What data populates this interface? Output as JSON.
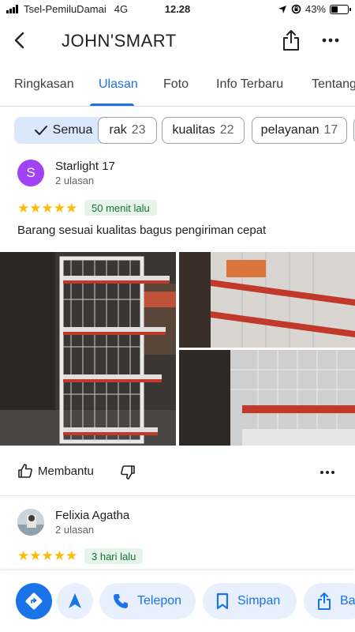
{
  "status_bar": {
    "carrier": "Tsel-PemiluDamai",
    "network": "4G",
    "time": "12.28",
    "battery_percent": "43%",
    "battery_level": 0.43
  },
  "header": {
    "title": "JOHN'SMART"
  },
  "tabs": [
    {
      "label": "Ringkasan"
    },
    {
      "label": "Ulasan"
    },
    {
      "label": "Foto"
    },
    {
      "label": "Info Terbaru"
    },
    {
      "label": "Tentang"
    }
  ],
  "chips": [
    {
      "label": "Semua",
      "count": ""
    },
    {
      "label": "rak",
      "count": "23"
    },
    {
      "label": "kualitas",
      "count": "22"
    },
    {
      "label": "pelayanan",
      "count": "17"
    }
  ],
  "reviews": [
    {
      "avatar_letter": "S",
      "avatar_color": "#a142f4",
      "name": "Starlight 17",
      "review_count": "2 ulasan",
      "stars": "★★★★★",
      "rating": 5,
      "time": "50 menit lalu",
      "text": "Barang sesuai kualitas bagus pengiriman cepat",
      "helpful_label": "Membantu"
    },
    {
      "avatar_letter": "",
      "name": "Felixia Agatha",
      "review_count": "2 ulasan",
      "stars": "★★★★★",
      "rating": 5,
      "time": "3 hari lalu"
    }
  ],
  "bottom_bar": {
    "call_label": "Telepon",
    "save_label": "Simpan",
    "share_label": "Ba"
  },
  "colors": {
    "accent": "#1a73e8",
    "star": "#fbbc04",
    "badge_bg": "#e6f4ea",
    "badge_text": "#137333"
  }
}
